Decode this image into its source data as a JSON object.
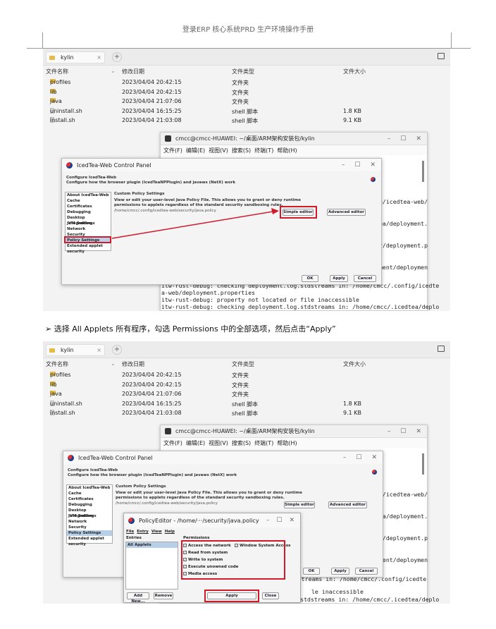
{
  "page_header": "登录ERP 核心系统PRD 生产环境操作手册",
  "instruction": "➢  选择 All Applets 所有程序，勾选 Permissions 中的全部选项，然后点击“Apply”",
  "file_manager": {
    "tab_label": "kylin",
    "tab_close": "×",
    "new_tab": "+",
    "columns": {
      "name": "文件名称",
      "date": "修改日期",
      "type": "文件类型",
      "size": "文件大小"
    },
    "rows": [
      {
        "name": "profiles",
        "date": "2023/04/04 20:42:15",
        "type": "文件夹",
        "size": "",
        "kind": "folder"
      },
      {
        "name": "lib",
        "date": "2023/04/04 20:42:15",
        "type": "文件夹",
        "size": "",
        "kind": "folder"
      },
      {
        "name": "java",
        "date": "2023/04/04 21:07:06",
        "type": "文件夹",
        "size": "",
        "kind": "folder"
      },
      {
        "name": "uninstall.sh",
        "date": "2023/04/04 16:15:25",
        "type": "shell 脚本",
        "size": "1.8 KB",
        "kind": "file"
      },
      {
        "name": "install.sh",
        "date": "2023/04/04 21:03:08",
        "type": "shell 脚本",
        "size": "9.1 KB",
        "kind": "file"
      }
    ]
  },
  "terminal": {
    "title": "cmcc@cmcc-HUAWEI: ~/桌面/ARM架构安装包/kylin",
    "minimize": "–",
    "maximize": "☐",
    "close": "✕",
    "menu": [
      "文件(F)",
      "编辑(E)",
      "视图(V)",
      "搜索(S)",
      "终端(T)",
      "帮助(H)"
    ],
    "right_fragments": [
      "g/icedtea-web/",
      "ea/deployment.",
      "y/deployment.p",
      "ment/deploymen"
    ],
    "lines_1": [
      "itw-rust-debug: checking deployment.log.stdstreams in: /home/cmcc/.config/icedte",
      "a-web/deployment.properties",
      "itw-rust-debug: property not located or file inaccessible",
      "itw-rust-debug: checking deployment.log.stdstreams in: /home/cmcc/.icedtea/deplo"
    ],
    "lines_2_a": "stdstreams in: /home/cmcc/.config/icedte",
    "lines_2_b": "le inaccessible",
    "lines_2_c": "itw-rust-debug: checking deployment.log.stdstreams in: /home/cmcc/.icedtea/deplo"
  },
  "icedtea": {
    "title": "IcedTea-Web Control Panel",
    "minimize": "–",
    "maximize": "☐",
    "close": "✕",
    "configure_title": "Configure IcedTea-Web",
    "configure_sub": "Configure how the browser plugin (IcedTeaNPPlugin) and javaws (NetX) work",
    "nav": [
      "About IcedTea-Web",
      "Cache",
      "Certificates",
      "Debugging",
      "Desktop Integration",
      "JVM Settings",
      "Network",
      "Security",
      "Policy Settings",
      "Extended applet security"
    ],
    "selected_nav": "Policy Settings",
    "section_title": "Custom Policy Settings",
    "desc1": "View or edit your user-level Java Policy File. This allows you to grant or deny runtime",
    "desc2": "permissions to applets regardless of the standard security sandboxing rules.",
    "policy_path": "/home/cmcc/.config/icedtea-web/security/java.policy",
    "simple_editor": "Simple editor",
    "advanced_editor": "Advanced editor",
    "ok": "OK",
    "apply": "Apply",
    "cancel": "Cancel"
  },
  "policy_editor": {
    "title": "PolicyEditor - /home/···/security/java.policy",
    "minimize": "–",
    "maximize": "☐",
    "close": "✕",
    "menu": [
      "File",
      "Entry",
      "View",
      "Help"
    ],
    "entries_label": "Entries",
    "permissions_label": "Permissions",
    "selected_entry": "All Applets",
    "permissions": [
      "Access the network",
      "Window System Access",
      "Read from system",
      "Write to system",
      "Execute unowned code",
      "Media access"
    ],
    "add_new": "Add New...",
    "remove": "Remove",
    "apply": "Apply",
    "close_btn": "Close"
  },
  "colors": {
    "highlight": "#d01a2a",
    "selection": "#b8cfe8",
    "folder": "#e5b94a"
  }
}
